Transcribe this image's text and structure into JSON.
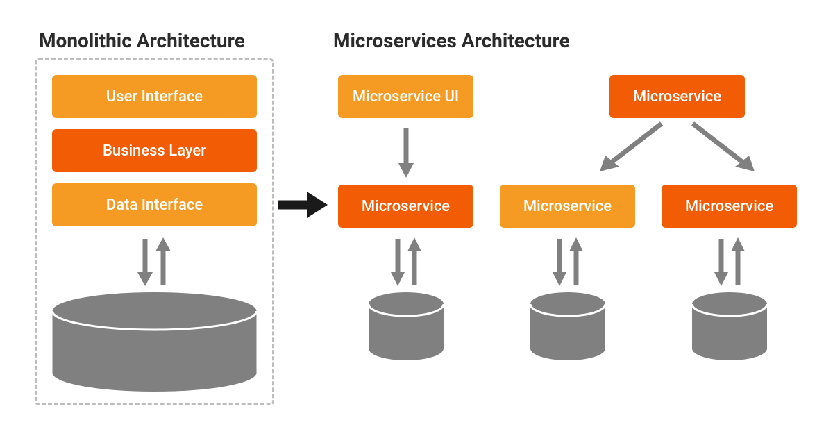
{
  "monolithic": {
    "title": "Monolithic Architecture",
    "layers": [
      "User Interface",
      "Business Layer",
      "Data Interface"
    ]
  },
  "microservices": {
    "title": "Microservices Architecture",
    "top_left": "Microservice UI",
    "top_right": "Microservice",
    "bottom": [
      "Microservice",
      "Microservice",
      "Microservice"
    ]
  },
  "colors": {
    "light": "#f59a23",
    "dark": "#f25c05",
    "gray": "#808080",
    "black": "#1a1a1a",
    "border": "#bdbdbd"
  }
}
